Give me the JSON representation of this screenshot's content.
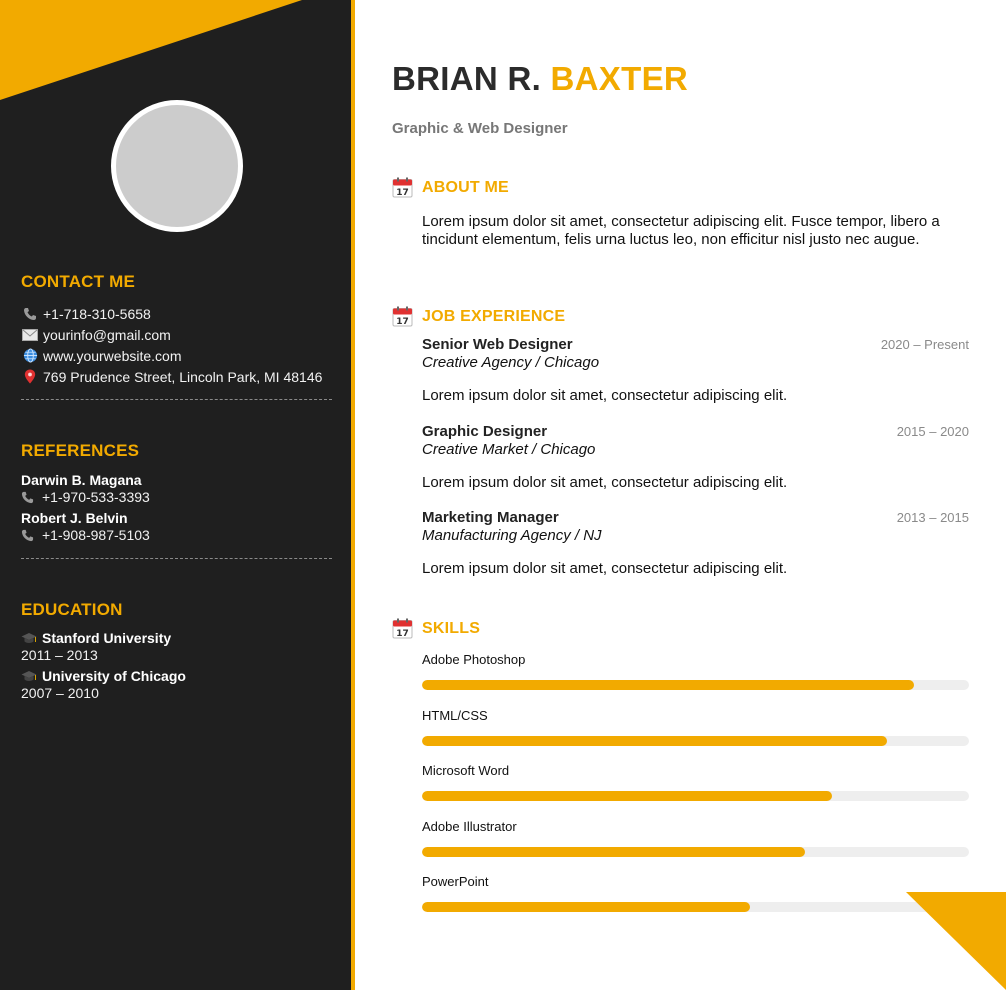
{
  "sidebar": {
    "contact": {
      "heading": "CONTACT ME",
      "phone": "+1-718-310-5658",
      "email": "yourinfo@gmail.com",
      "website": "www.yourwebsite.com",
      "address": "769 Prudence Street, Lincoln Park, MI 48146"
    },
    "references": {
      "heading": "REFERENCES",
      "items": [
        {
          "name": "Darwin B. Magana",
          "phone": "+1-970-533-3393"
        },
        {
          "name": "Robert J. Belvin",
          "phone": "+1-908-987-5103"
        }
      ]
    },
    "education": {
      "heading": "EDUCATION",
      "items": [
        {
          "school": "Stanford University",
          "years": "2011 – 2013"
        },
        {
          "school": "University of Chicago",
          "years": "2007 – 2010"
        }
      ]
    }
  },
  "header": {
    "first_name": "BRIAN R.",
    "last_name": "BAXTER",
    "title": "Graphic & Web Designer"
  },
  "about": {
    "heading": "ABOUT ME",
    "text": "Lorem ipsum dolor sit amet, consectetur adipiscing elit. Fusce tempor, libero a tincidunt elementum, felis urna luctus leo, non efficitur nisl justo nec augue."
  },
  "experience": {
    "heading": "JOB EXPERIENCE",
    "jobs": [
      {
        "title": "Senior Web Designer",
        "years": "2020 – Present",
        "place": "Creative Agency / Chicago",
        "desc": "Lorem ipsum dolor sit amet, consectetur adipiscing elit."
      },
      {
        "title": "Graphic Designer",
        "years": "2015 – 2020",
        "place": "Creative Market / Chicago",
        "desc": "Lorem ipsum dolor sit amet, consectetur adipiscing elit."
      },
      {
        "title": "Marketing Manager",
        "years": "2013 – 2015",
        "place": "Manufacturing Agency / NJ",
        "desc": "Lorem ipsum dolor sit amet, consectetur adipiscing elit."
      }
    ]
  },
  "skills": {
    "heading": "SKILLS",
    "items": [
      {
        "name": "Adobe Photoshop",
        "level": 0.9
      },
      {
        "name": "HTML/CSS",
        "level": 0.85
      },
      {
        "name": "Microsoft Word",
        "level": 0.75
      },
      {
        "name": "Adobe Illustrator",
        "level": 0.7
      },
      {
        "name": "PowerPoint",
        "level": 0.6
      }
    ]
  },
  "icons": {
    "phone": "phone-icon",
    "email": "envelope-icon",
    "website": "globe-icon",
    "address": "map-pin-icon",
    "education": "graduation-cap-icon",
    "section": "calendar-icon"
  },
  "colors": {
    "accent": "#f2aa00",
    "sidebar_bg": "#1f1f1f",
    "skill_track": "#eeeeee"
  }
}
